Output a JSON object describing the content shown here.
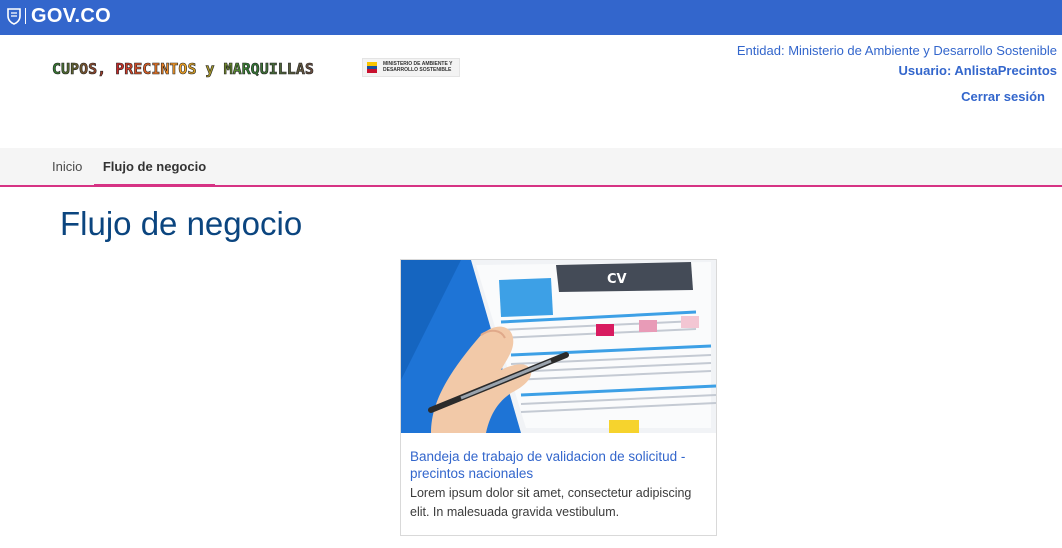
{
  "gov_bar": {
    "brand": "GOV.CO",
    "icon": "colombia-shield-icon",
    "color": "#3366cc"
  },
  "header": {
    "logo_text": "CUPOS, PRECINTOS y MARQUILLAS",
    "ministry_logo_text": "MINISTERIO DE AMBIENTE Y DESARROLLO SOSTENIBLE",
    "entity": "Entidad: Ministerio de Ambiente y Desarrollo Sostenible",
    "user": "Usuario: AnlistaPrecintos",
    "logout": "Cerrar sesión"
  },
  "nav": {
    "items": [
      "Inicio",
      "Flujo de negocio"
    ],
    "active": "Flujo de negocio",
    "accent": "#d63384"
  },
  "main": {
    "title": "Flujo de negocio",
    "card": {
      "image_icon": "cv-document-with-pen-image",
      "image_text": "CV",
      "title": "Bandeja de trabajo de validacion de solicitud - precintos nacionales",
      "description": "Lorem ipsum dolor sit amet, consectetur adipiscing elit. In malesuada gravida vestibulum."
    }
  }
}
